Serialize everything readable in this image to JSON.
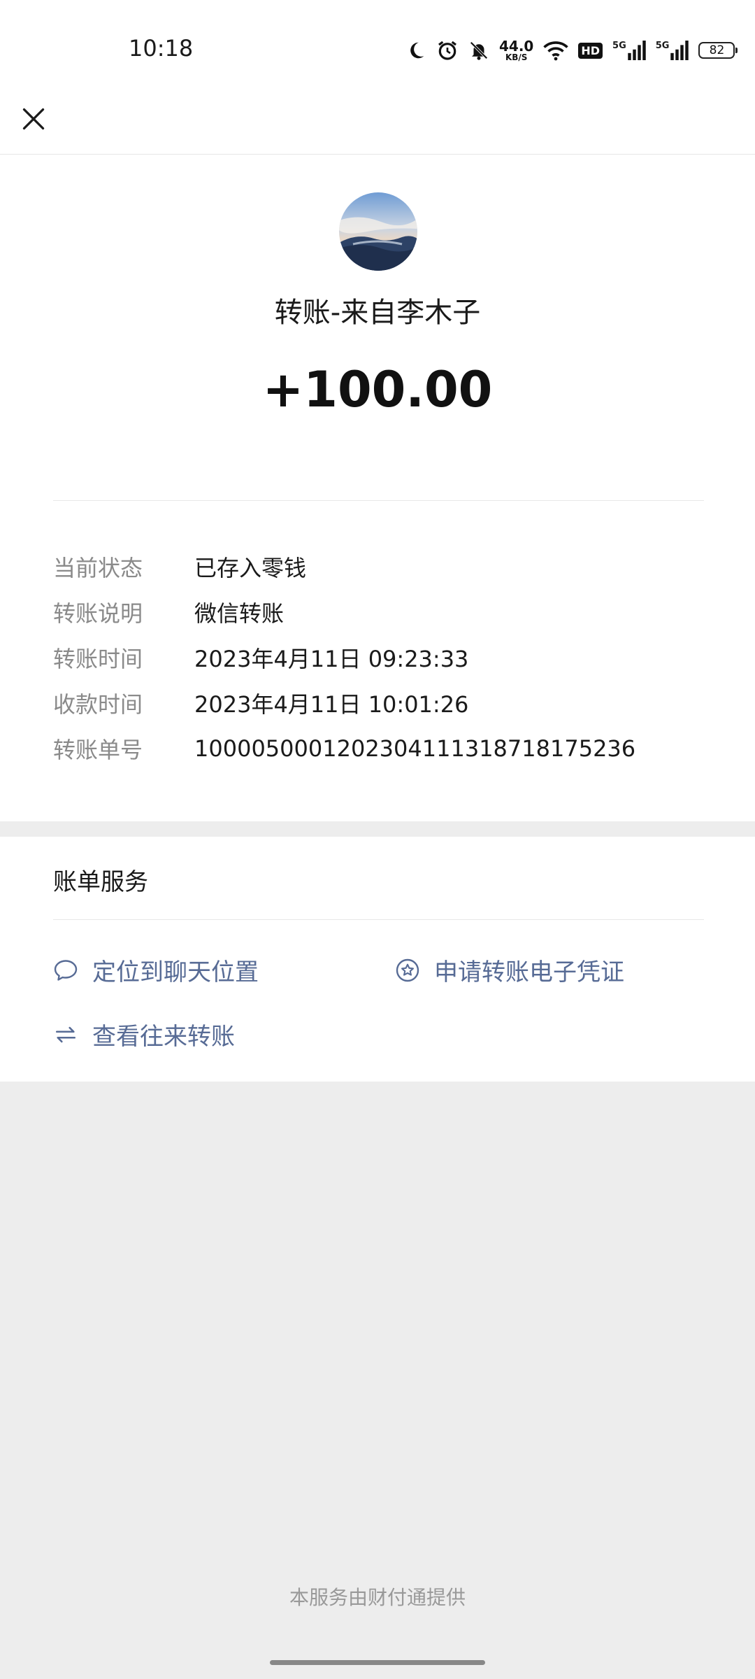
{
  "status_bar": {
    "time": "10:18",
    "net_speed_value": "44.0",
    "net_speed_unit": "KB/S",
    "hd_label": "HD",
    "signal_label_1": "5G",
    "signal_label_2": "5G",
    "battery": "82",
    "icons": [
      "moon-icon",
      "alarm-icon",
      "mute-bell-icon",
      "wifi-icon",
      "hd-icon",
      "signal-5g-icon",
      "signal-5g-icon",
      "battery-icon"
    ]
  },
  "header": {
    "close_icon": "close-icon"
  },
  "transfer": {
    "title": "转账-来自李木子",
    "amount": "+100.00",
    "details": [
      {
        "label": "当前状态",
        "value": "已存入零钱"
      },
      {
        "label": "转账说明",
        "value": "微信转账"
      },
      {
        "label": "转账时间",
        "value": "2023年4月11日 09:23:33"
      },
      {
        "label": "收款时间",
        "value": "2023年4月11日 10:01:26"
      },
      {
        "label": "转账单号",
        "value": "1000050001202304111318718175236"
      }
    ]
  },
  "services": {
    "title": "账单服务",
    "locate_chat": "定位到聊天位置",
    "apply_voucher": "申请转账电子凭证",
    "view_transfers": "查看往来转账"
  },
  "footer": {
    "text": "本服务由财付通提供"
  },
  "colors": {
    "link": "#576b95",
    "label_gray": "#8a8a8a",
    "background": "#ededed"
  }
}
